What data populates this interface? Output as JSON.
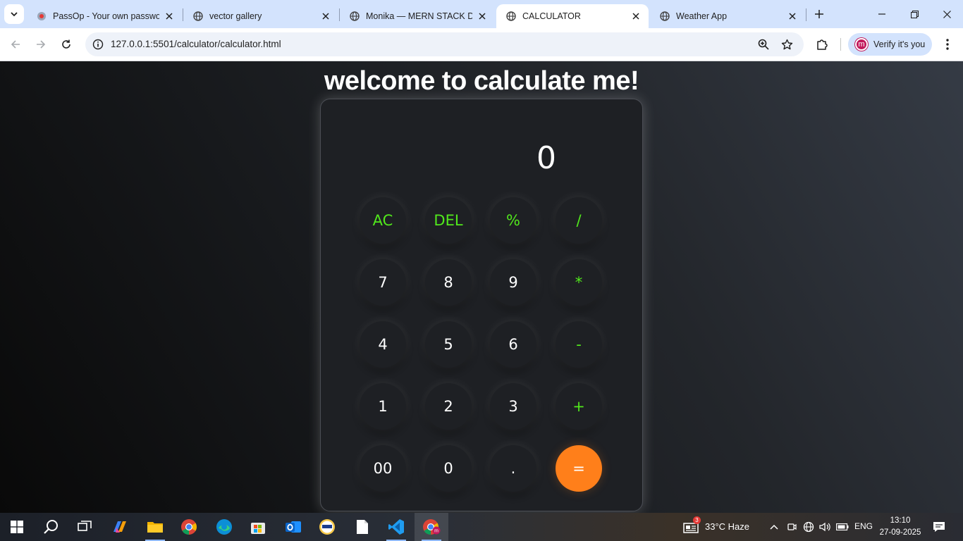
{
  "browser": {
    "tabs": [
      {
        "title": "PassOp - Your own password",
        "active": false
      },
      {
        "title": "vector gallery",
        "active": false
      },
      {
        "title": "Monika — MERN STACK DEV",
        "active": false
      },
      {
        "title": "CALCULATOR",
        "active": true
      },
      {
        "title": "Weather App",
        "active": false
      }
    ],
    "url": "127.0.0.1:5501/calculator/calculator.html",
    "profile_label": "Verify it's you",
    "profile_initial": "m"
  },
  "page": {
    "heading": "welcome to calculate me!",
    "display_value": "0",
    "keys": [
      {
        "label": "AC",
        "kind": "op"
      },
      {
        "label": "DEL",
        "kind": "op"
      },
      {
        "label": "%",
        "kind": "op"
      },
      {
        "label": "/",
        "kind": "op"
      },
      {
        "label": "7",
        "kind": "num"
      },
      {
        "label": "8",
        "kind": "num"
      },
      {
        "label": "9",
        "kind": "num"
      },
      {
        "label": "*",
        "kind": "op"
      },
      {
        "label": "4",
        "kind": "num"
      },
      {
        "label": "5",
        "kind": "num"
      },
      {
        "label": "6",
        "kind": "num"
      },
      {
        "label": "-",
        "kind": "op"
      },
      {
        "label": "1",
        "kind": "num"
      },
      {
        "label": "2",
        "kind": "num"
      },
      {
        "label": "3",
        "kind": "num"
      },
      {
        "label": "+",
        "kind": "op"
      },
      {
        "label": "00",
        "kind": "num"
      },
      {
        "label": "0",
        "kind": "num"
      },
      {
        "label": ".",
        "kind": "num"
      },
      {
        "label": "=",
        "kind": "equals"
      }
    ]
  },
  "taskbar": {
    "apps": [
      "start-icon",
      "search-icon",
      "task-view-icon",
      "copilot-icon",
      "file-explorer-icon",
      "chrome-icon",
      "edge-icon",
      "store-icon",
      "outlook-icon",
      "wah-app-icon",
      "notepad-icon",
      "vscode-icon",
      "chrome-profile-icon"
    ],
    "news_badge": "3",
    "weather": "33°C  Haze",
    "language": "ENG",
    "time": "13:10",
    "date": "27-09-2025"
  },
  "colors": {
    "operator": "#51e81c",
    "equals": "#ff7f1a",
    "tabstrip": "#d3e3fd"
  }
}
